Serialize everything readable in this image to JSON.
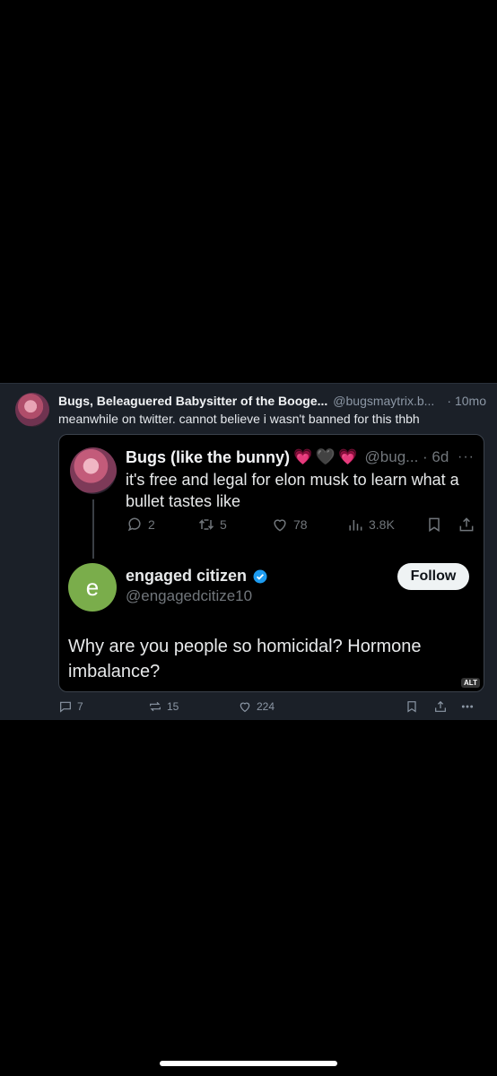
{
  "outer_post": {
    "author_name": "Bugs, Beleaguered Babysitter of the Booge...",
    "author_handle": "@bugsmaytrix.b...",
    "time": "· 10mo",
    "text": "meanwhile on twitter. cannot believe i wasn't banned for this thbh",
    "replies": "7",
    "reposts": "15",
    "likes": "224"
  },
  "quoted_tweet": {
    "author_name": "Bugs (like the bunny)",
    "emoji": [
      "💗",
      "🖤",
      "💗"
    ],
    "handle_time": "@bug... · 6d",
    "more": "···",
    "text": "it's free and legal for elon musk to learn what a bullet tastes like",
    "replies": "2",
    "retweets": "5",
    "likes": "78",
    "views": "3.8K"
  },
  "reply_tweet": {
    "avatar_letter": "e",
    "author_name": "engaged citizen",
    "handle": "@engagedcitize10",
    "follow_label": "Follow",
    "text": "Why are you people so homicidal? Hormone imbalance?",
    "alt_label": "ALT"
  },
  "colors": {
    "post_bg": "#1b2028",
    "accent_verified": "#1d9bf0",
    "avatar_e": "#7aad4b"
  }
}
